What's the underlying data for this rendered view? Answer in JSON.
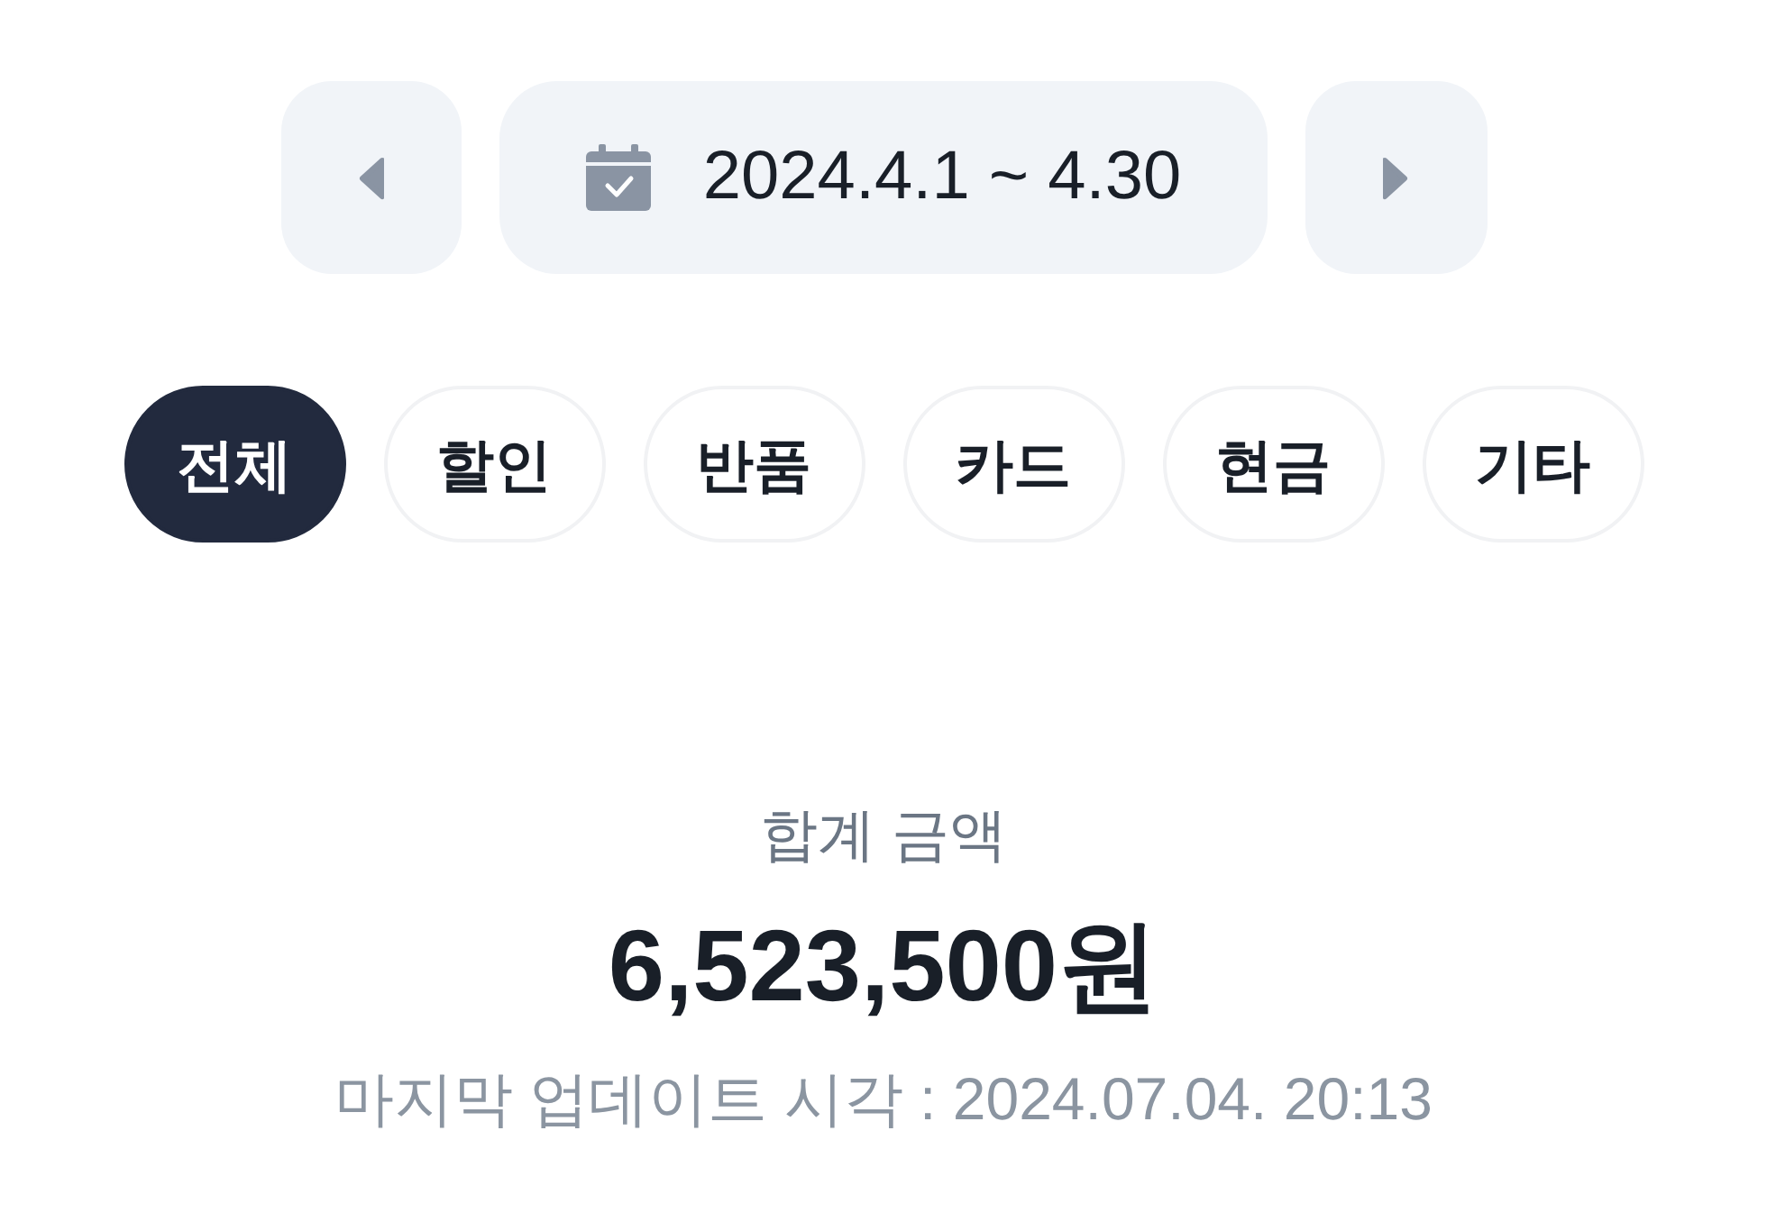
{
  "date_range": {
    "label": "2024.4.1 ~ 4.30"
  },
  "filters": [
    {
      "label": "전체",
      "selected": true
    },
    {
      "label": "할인",
      "selected": false
    },
    {
      "label": "반품",
      "selected": false
    },
    {
      "label": "카드",
      "selected": false
    },
    {
      "label": "현금",
      "selected": false
    },
    {
      "label": "기타",
      "selected": false
    }
  ],
  "total": {
    "label": "합계 금액",
    "amount": "6,523,500원",
    "updated": "마지막 업데이트 시각 : 2024.07.04. 20:13"
  }
}
